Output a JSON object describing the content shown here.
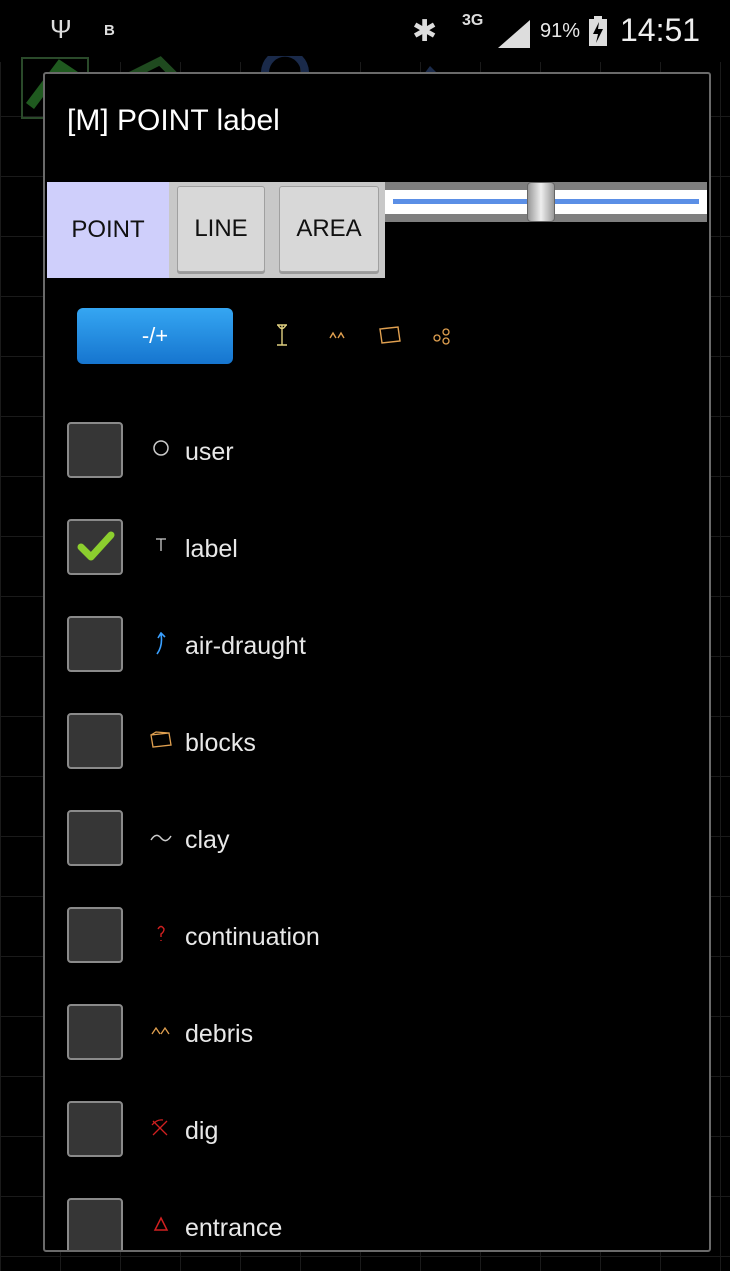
{
  "status_bar": {
    "left_letter": "B",
    "network": "3G",
    "battery": "91%",
    "time": "14:51"
  },
  "dialog": {
    "title": "[M] POINT label",
    "types": {
      "point": "POINT",
      "line": "LINE",
      "area": "AREA",
      "selected": "POINT"
    },
    "zoom_slider": {
      "level": 0.48
    },
    "toggle_button": "-/+",
    "filter_icons": [
      "point-filter-icon",
      "debris-filter-icon",
      "blocks-filter-icon",
      "pebbles-filter-icon"
    ],
    "symbols": [
      {
        "label": "user",
        "checked": false,
        "icon": "circle-icon",
        "color": "#cccccc"
      },
      {
        "label": "label",
        "checked": true,
        "icon": "text-icon",
        "color": "#cccccc"
      },
      {
        "label": "air-draught",
        "checked": false,
        "icon": "arrow-up-icon",
        "color": "#3aa0ff"
      },
      {
        "label": "blocks",
        "checked": false,
        "icon": "blocks-icon",
        "color": "#e0a050"
      },
      {
        "label": "clay",
        "checked": false,
        "icon": "tilde-icon",
        "color": "#cccccc"
      },
      {
        "label": "continuation",
        "checked": false,
        "icon": "question-icon",
        "color": "#d02020"
      },
      {
        "label": "debris",
        "checked": false,
        "icon": "debris-icon",
        "color": "#e0a050"
      },
      {
        "label": "dig",
        "checked": false,
        "icon": "pickaxe-icon",
        "color": "#d02020"
      },
      {
        "label": "entrance",
        "checked": false,
        "icon": "triangle-icon",
        "color": "#d02020"
      }
    ]
  }
}
